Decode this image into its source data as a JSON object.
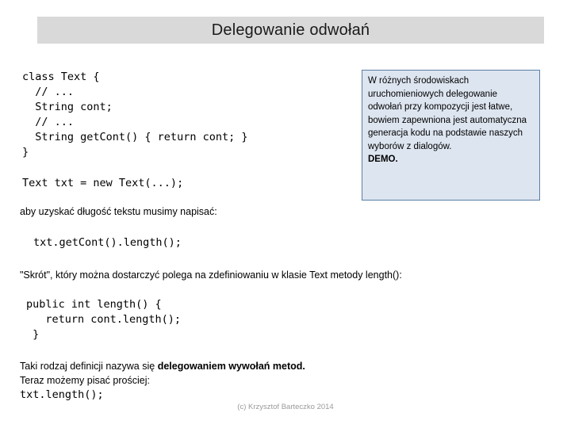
{
  "slide": {
    "title": "Delegowanie odwołań",
    "title_bg": "#d9d9d9",
    "background": "#ffffff"
  },
  "code": {
    "class_definition": "class Text {\n  // ...\n  String cont;\n  // ...\n  String getCont() { return cont; }\n}",
    "instantiate": "Text txt = new Text(...);",
    "length_call": "txt.getCont().length();",
    "length_impl": "public int length() {\n   return cont.length();\n }",
    "short_call": "txt.length();"
  },
  "prose": {
    "intro": "aby uzyskać długość tekstu musimy napisać:",
    "shortcut": "\"Skrót\", który można dostarczyć polega na zdefiniowaniu w klasie Text metody length():",
    "conclusion_plain": "Taki rodzaj definicji nazywa się ",
    "conclusion_bold": "delegowaniem wywołań metod.",
    "simpler": "Teraz możemy pisać prościej:"
  },
  "callout": {
    "body": "W różnych środowiskach uruchomieniowych delegowanie odwołań przy kompozycji jest łatwe, bowiem zapewniona jest automatyczna generacja kodu na podstawie naszych wyborów z dialogów.",
    "demo": "DEMO.",
    "fill_color": "#dde5f0",
    "border_color": "#5a7fa6"
  },
  "footer": {
    "credit": "(c) Krzysztof Barteczko 2014",
    "color": "#9a9a9a"
  }
}
